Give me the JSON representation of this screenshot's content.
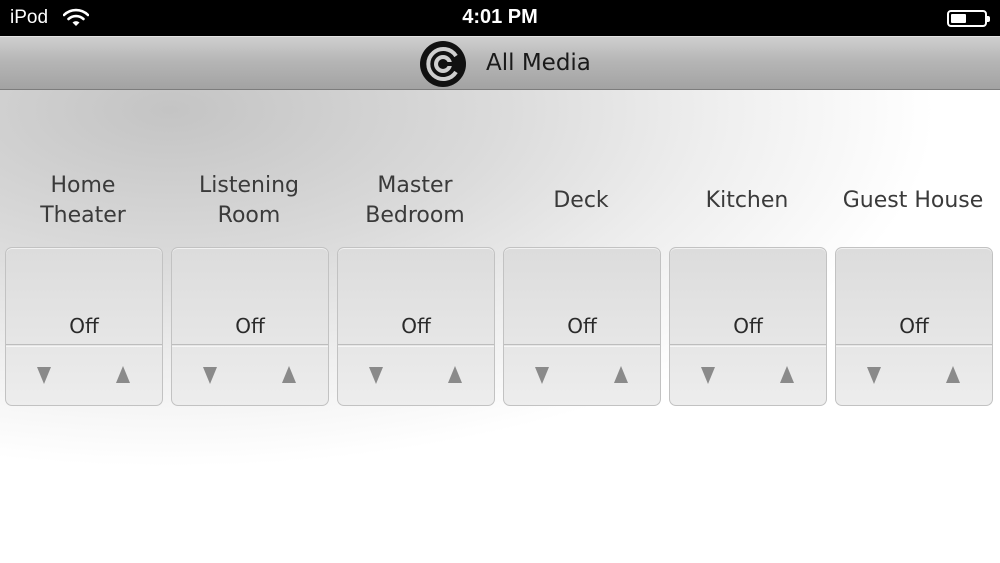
{
  "status_bar": {
    "device": "iPod",
    "time": "4:01 PM",
    "icons": [
      "wifi-icon",
      "battery-icon"
    ]
  },
  "header": {
    "title": "All Media",
    "logo": "speaker-logo-icon"
  },
  "zones": [
    {
      "name": "Home\nTheater",
      "status": "Off"
    },
    {
      "name": "Listening\nRoom",
      "status": "Off"
    },
    {
      "name": "Master\nBedroom",
      "status": "Off"
    },
    {
      "name": "Deck",
      "status": "Off"
    },
    {
      "name": "Kitchen",
      "status": "Off"
    },
    {
      "name": "Guest House",
      "status": "Off"
    }
  ],
  "controls": {
    "down_icon": "volume-down-triangle-icon",
    "up_icon": "volume-up-triangle-icon",
    "arrow_color": "#8a8a8a"
  }
}
